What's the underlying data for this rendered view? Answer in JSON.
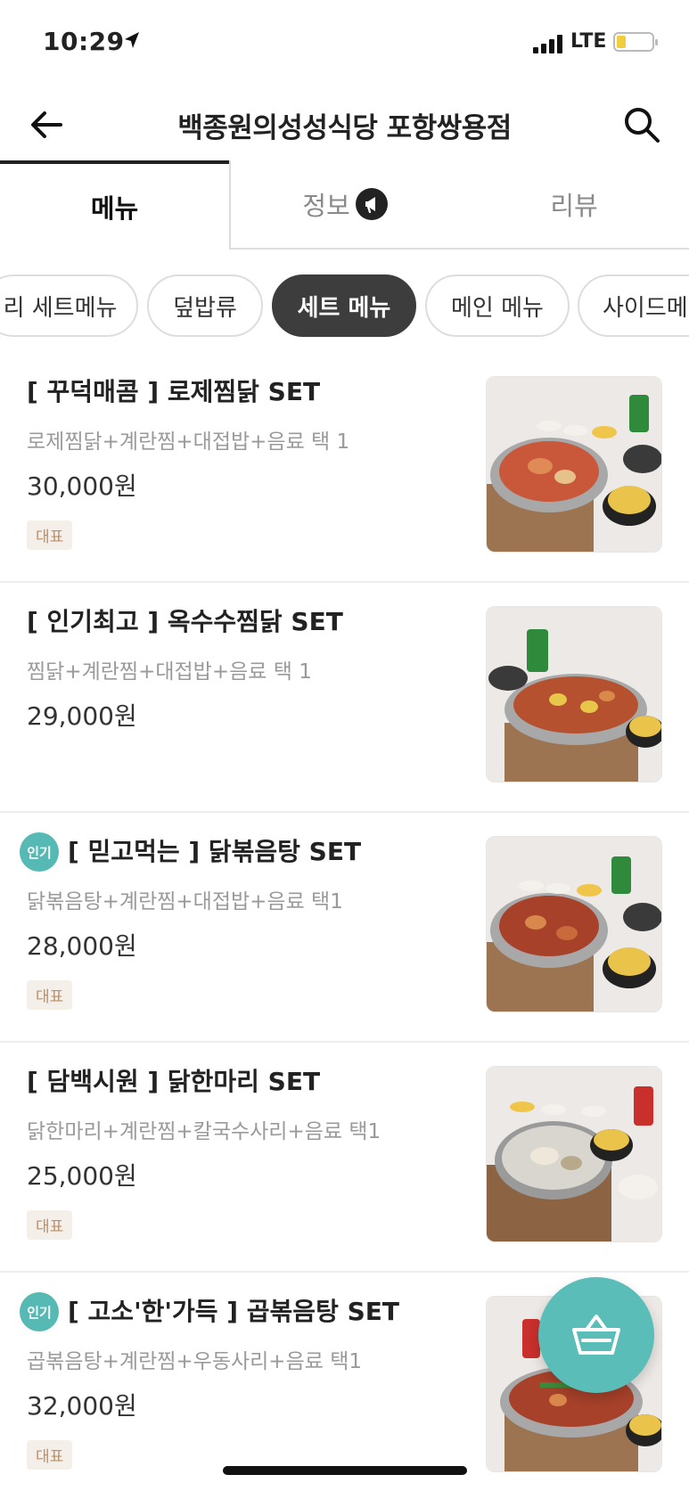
{
  "status_bar": {
    "time": "10:29",
    "network": "LTE",
    "battery_level": 0.25
  },
  "header": {
    "title": "백종원의성성식당 포항쌍용점"
  },
  "tabs": [
    {
      "label": "메뉴",
      "active": true
    },
    {
      "label": "정보"
    },
    {
      "label": "리뷰"
    }
  ],
  "categories": [
    {
      "label": "리 세트메뉴"
    },
    {
      "label": "덮밥류"
    },
    {
      "label": "세트 메뉴",
      "active": true
    },
    {
      "label": "메인 메뉴"
    },
    {
      "label": "사이드메"
    }
  ],
  "menu_items": [
    {
      "name": "[ 꾸덕매콤 ] 로제찜닭 SET",
      "desc": "로제찜닭+계란찜+대접밥+음료 택 1",
      "price": "30,000원",
      "tag": "대표",
      "popular": null
    },
    {
      "name": "[ 인기최고 ] 옥수수찜닭 SET",
      "desc": "찜닭+계란찜+대접밥+음료 택 1",
      "price": "29,000원",
      "tag": null,
      "popular": null
    },
    {
      "name": "[ 믿고먹는 ] 닭볶음탕 SET",
      "desc": "닭볶음탕+계란찜+대접밥+음료 택1",
      "price": "28,000원",
      "tag": "대표",
      "popular": "인기"
    },
    {
      "name": "[ 담백시원 ] 닭한마리 SET",
      "desc": "닭한마리+계란찜+칼국수사리+음료 택1",
      "price": "25,000원",
      "tag": "대표",
      "popular": null
    },
    {
      "name": "[ 고소'한'가득 ] 곱볶음탕 SET",
      "desc": "곱볶음탕+계란찜+우동사리+음료 택1",
      "price": "32,000원",
      "tag": "대표",
      "popular": "인기"
    }
  ],
  "colors": {
    "accent": "#5bbdb7",
    "active_chip": "#3d3d3d",
    "tag_text": "#b88f6a",
    "tag_bg": "#f5efe9"
  }
}
